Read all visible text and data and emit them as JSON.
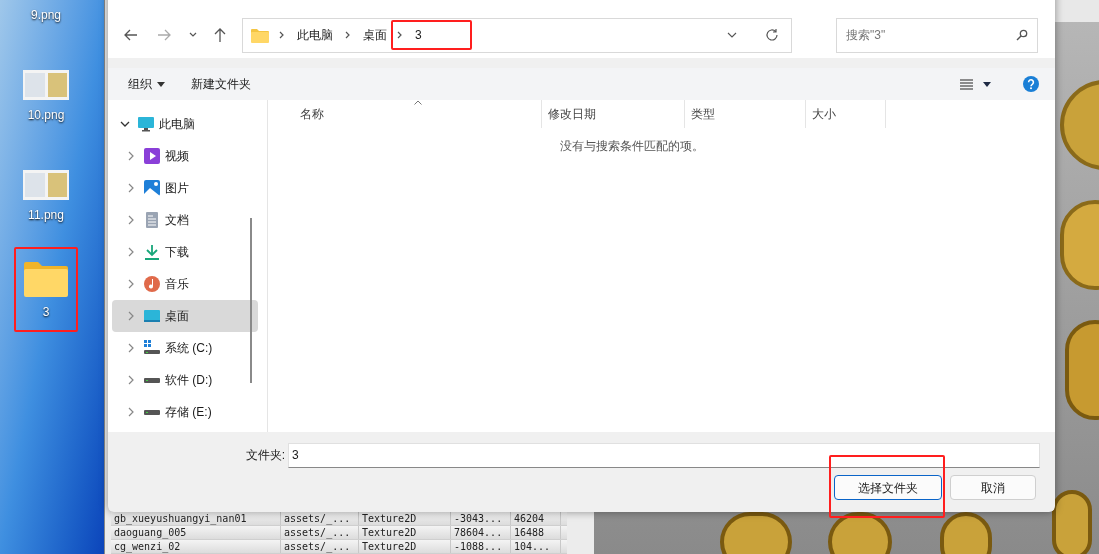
{
  "desktop": {
    "icons": [
      {
        "label": "9.png",
        "kind": "image"
      },
      {
        "label": "10.png",
        "kind": "image"
      },
      {
        "label": "11.png",
        "kind": "image"
      },
      {
        "label": "3",
        "kind": "folder"
      }
    ]
  },
  "dialog": {
    "address": {
      "breadcrumbs": [
        "此电脑",
        "桌面",
        "3"
      ]
    },
    "search": {
      "placeholder": "搜索\"3\""
    },
    "toolbar": {
      "organize": "组织",
      "new_folder": "新建文件夹"
    },
    "nav_tree": [
      {
        "label": "此电脑",
        "kind": "pc",
        "expanded": true,
        "selected": false,
        "children": [
          {
            "label": "视频",
            "kind": "video",
            "expanded": false,
            "selected": false
          },
          {
            "label": "图片",
            "kind": "pictures",
            "expanded": false,
            "selected": false
          },
          {
            "label": "文档",
            "kind": "documents",
            "expanded": false,
            "selected": false
          },
          {
            "label": "下载",
            "kind": "downloads",
            "expanded": false,
            "selected": false
          },
          {
            "label": "音乐",
            "kind": "music",
            "expanded": false,
            "selected": false
          },
          {
            "label": "桌面",
            "kind": "desktop",
            "expanded": false,
            "selected": true
          },
          {
            "label": "系统 (C:)",
            "kind": "system_drive",
            "expanded": false,
            "selected": false
          },
          {
            "label": "软件 (D:)",
            "kind": "drive",
            "expanded": false,
            "selected": false
          },
          {
            "label": "存储 (E:)",
            "kind": "drive",
            "expanded": false,
            "selected": false
          }
        ]
      }
    ],
    "columns": [
      "名称",
      "修改日期",
      "类型",
      "大小"
    ],
    "empty_message": "没有与搜索条件匹配的项。",
    "folder_field": {
      "label": "文件夹:",
      "value": "3"
    },
    "buttons": [
      {
        "label": "选择文件夹",
        "default": true
      },
      {
        "label": "取消",
        "default": false
      }
    ]
  },
  "background_table": {
    "rows": [
      [
        "gb_xueyushuangyi_nan01",
        "assets/_...",
        "Texture2D",
        "-3043...",
        "46204"
      ],
      [
        "daoguang_005",
        "assets/_...",
        "Texture2D",
        "78604...",
        "16488"
      ],
      [
        "cg_wenzi_02",
        "assets/_...",
        "Texture2D",
        "-1088...",
        "104..."
      ]
    ]
  },
  "annotations": {
    "breadcrumb_highlighted": true,
    "desktop_folder_highlighted": true,
    "confirm_button_highlighted": true
  }
}
